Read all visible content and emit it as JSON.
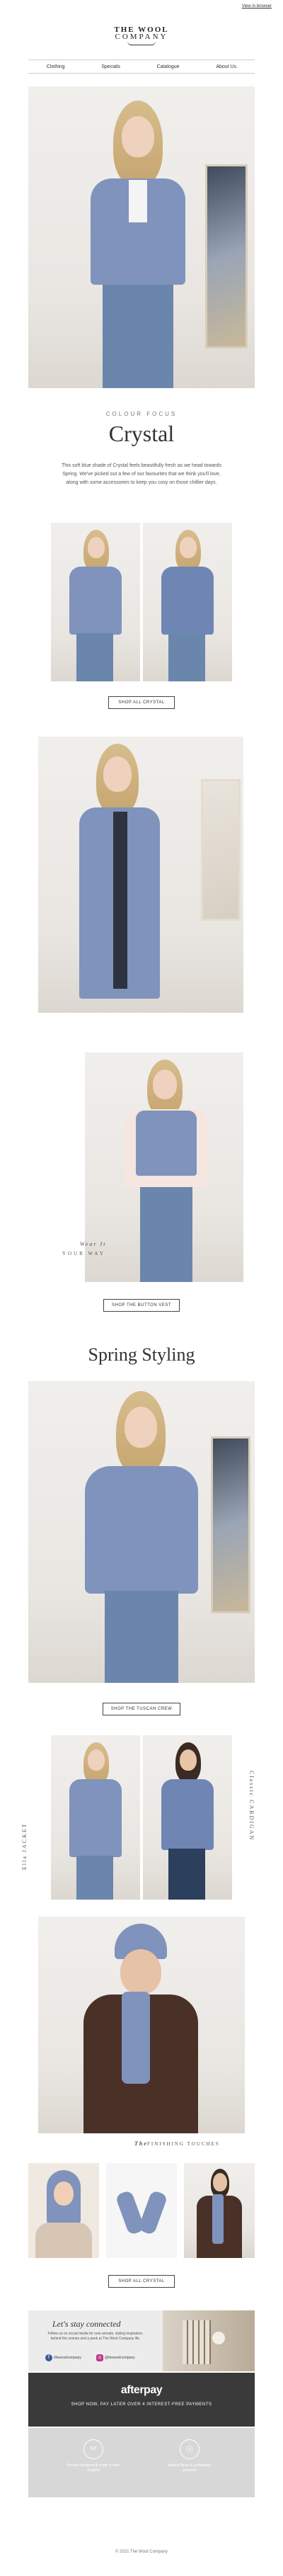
{
  "header": {
    "view_in_browser": "View in browser"
  },
  "logo": {
    "line1": "THE WOOL",
    "line2": "COMPANY"
  },
  "nav": {
    "items": [
      "Clothing",
      "Specials",
      "Catalogue",
      "About Us"
    ]
  },
  "intro": {
    "eyebrow": "COLOUR FOCUS",
    "title": "Crystal",
    "body": "This soft blue shade of Crystal feels beautifully fresh as we head towards Spring. We've picked out a few of our favourites that we think you'll love, along with some accessories to keep you cosy on those chillier days.",
    "button": "SHOP ALL CRYSTAL"
  },
  "wear_it": {
    "line1": "Wear It",
    "line2": "YOUR WAY",
    "button": "SHOP THE BUTTON VEST"
  },
  "spring": {
    "title": "Spring Styling",
    "button": "SHOP THE TUSCAN CREW"
  },
  "duo": {
    "left_label": "Ella JACKET",
    "right_label": "Classic CARDIGAN"
  },
  "finishing": {
    "text_script": "The",
    "text_caps": "FINISHING TOUCHES",
    "button": "SHOP ALL CRYSTAL"
  },
  "stay_connected": {
    "title": "Let's stay connected",
    "body": "Follow us on social media for new arrivals, styling inspiration, behind the scenes and a peek at The Wool Company life.",
    "facebook": "/thewoolcompany",
    "instagram": "@thewoolcompany"
  },
  "afterpay": {
    "logo": "afterpay",
    "tagline": "SHOP NOW, PAY LATER OVER 4 INTEREST-FREE PAYMENTS"
  },
  "badges": [
    {
      "icon": "NZ",
      "text": "Proudly designed & made in New Zealand"
    },
    {
      "icon": "☉",
      "text": "Natural fibres & sustainable practices"
    }
  ],
  "footer": {
    "copyright": "© 2021 The Wool Company"
  },
  "colors": {
    "accent": "#7f93bc",
    "dark": "#3a3a3a"
  }
}
